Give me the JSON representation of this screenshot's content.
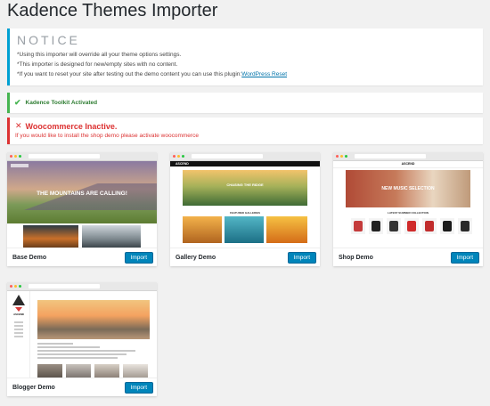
{
  "page": {
    "title": "Kadence Themes Importer"
  },
  "notice": {
    "heading": "NOTICE",
    "lines": [
      "*Using this importer will override all your theme options settings.",
      "*This importer is designed for new/empty sites with no content.",
      "*If you want to reset your site after testing out the demo content you can use this plugin:"
    ],
    "link_label": "WordPress Reset"
  },
  "success": {
    "icon": "check-icon",
    "text": "Kadence Toolkit Activated"
  },
  "error": {
    "icon": "x-icon",
    "title": "Woocommerce Inactive.",
    "subtitle": "If you would like to install the shop demo please activate woocommerce"
  },
  "demos": [
    {
      "name": "Base Demo",
      "button": "Import",
      "preview_headline": "THE MOUNTAINS ARE CALLING!"
    },
    {
      "name": "Gallery Demo",
      "button": "Import",
      "preview_logo": "ASCEND",
      "preview_headline": "CHASING THE RIDGE",
      "preview_section": "FEATURED GALLERIES"
    },
    {
      "name": "Shop Demo",
      "button": "Import",
      "preview_brand": "ASCEND",
      "preview_headline": "NEW MUSIC SELECTION",
      "preview_section": "LATEST SUMMER COLLECTION"
    },
    {
      "name": "Blogger Demo",
      "button": "Import",
      "preview_brand": "ASCEND"
    }
  ],
  "colors": {
    "notice_border": "#00a0d2",
    "success_border": "#46b450",
    "error_border": "#dc3232",
    "button": "#0085ba"
  }
}
